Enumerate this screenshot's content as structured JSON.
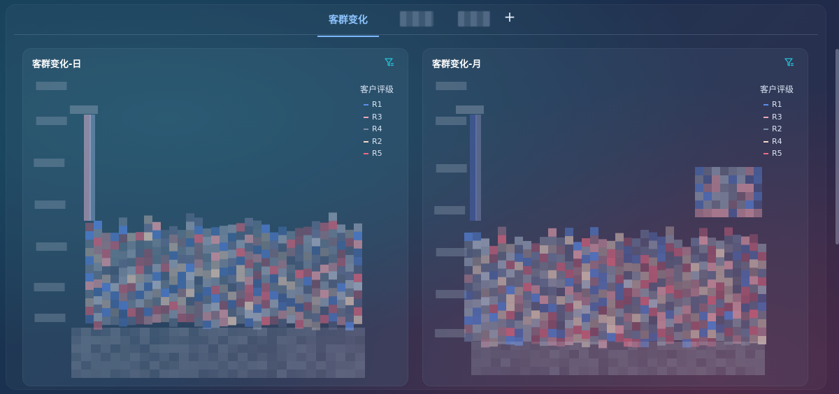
{
  "tabs": [
    {
      "label": "客群变化",
      "active": true
    },
    {
      "label": "",
      "blurred": true
    },
    {
      "label": "",
      "blurred": true
    }
  ],
  "add_tab_label": "+",
  "panels": [
    {
      "title": "客群变化-日",
      "legend_title": "客户评级",
      "legend": [
        {
          "name": "R1",
          "color": "#5b8dee"
        },
        {
          "name": "R3",
          "color": "#f2a7b5"
        },
        {
          "name": "R4",
          "color": "#7a8fa6"
        },
        {
          "name": "R2",
          "color": "#f3d7c6"
        },
        {
          "name": "R5",
          "color": "#ec6b85"
        }
      ]
    },
    {
      "title": "客群变化-月",
      "legend_title": "客户评级",
      "legend": [
        {
          "name": "R1",
          "color": "#5b8dee"
        },
        {
          "name": "R3",
          "color": "#f2a7b5"
        },
        {
          "name": "R2",
          "color": "#7a8fa6"
        },
        {
          "name": "R4",
          "color": "#f3d7c6"
        },
        {
          "name": "R5",
          "color": "#ec6b85"
        }
      ]
    }
  ],
  "icons": {
    "filter": "filter-icon",
    "add": "plus-icon"
  },
  "colors": {
    "accent": "#7db8ff",
    "filter_icon": "#21c3d6"
  }
}
